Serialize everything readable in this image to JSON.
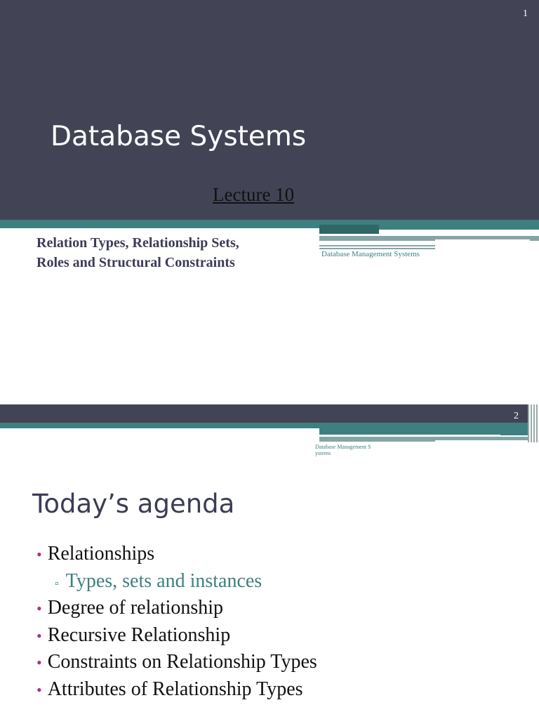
{
  "slide1": {
    "number": "1",
    "title": "Database Systems",
    "lecture": "Lecture 10",
    "subtitle_lines": [
      "Relation Types, Relationship Sets,",
      "Roles and Structural Constraints"
    ],
    "footer": "Database Management Systems"
  },
  "slide2": {
    "number": "2",
    "footer_lines": [
      "Database Management S",
      "ystems"
    ],
    "title": "Today’s agenda",
    "bullets": [
      {
        "text": "Relationships",
        "level": 1
      },
      {
        "text": "Types, sets and instances",
        "level": 2
      },
      {
        "text": "Degree of relationship",
        "level": 1
      },
      {
        "text": "Recursive Relationship",
        "level": 1
      },
      {
        "text": "Constraints on Relationship Types",
        "level": 1
      },
      {
        "text": "Attributes of Relationship Types",
        "level": 1
      }
    ]
  },
  "colors": {
    "dark": "#424456",
    "teal": "#3e7f80",
    "bullet": "#a8327e"
  }
}
